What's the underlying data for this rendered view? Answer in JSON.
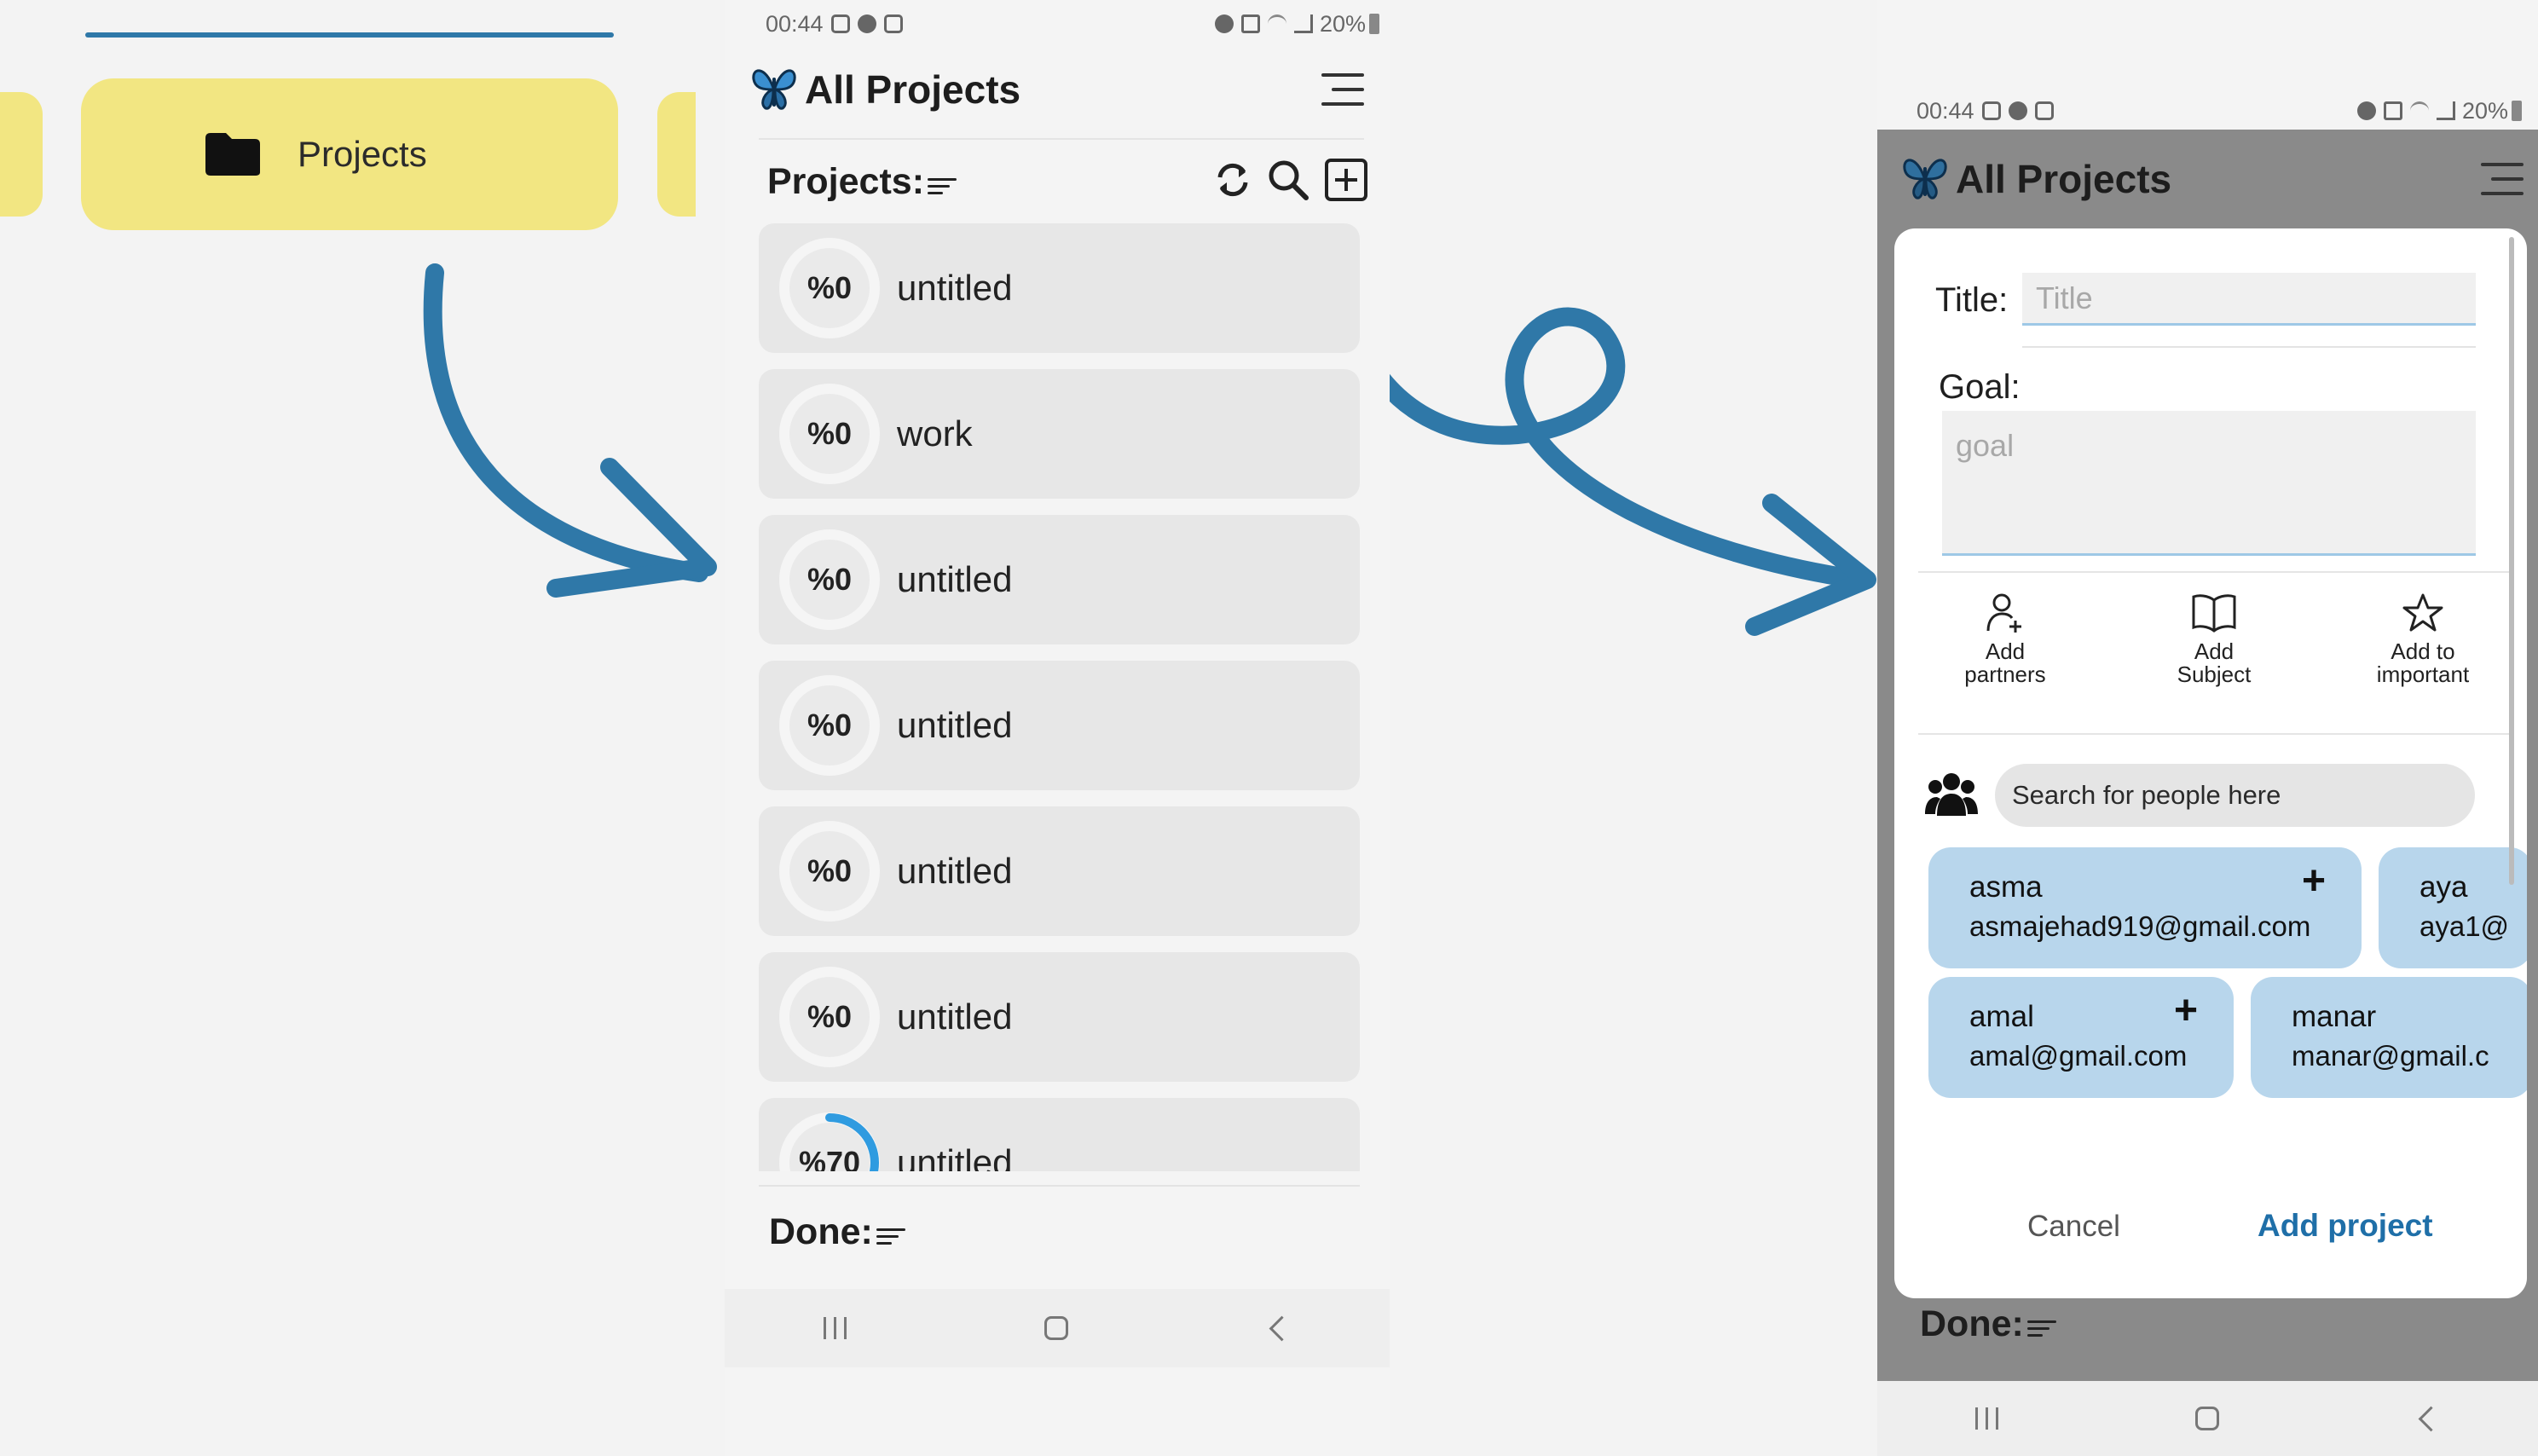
{
  "panel1": {
    "card_label": "Projects"
  },
  "panel2": {
    "status": {
      "time": "00:44",
      "battery": "20%"
    },
    "app_title": "All Projects",
    "section_title": "Projects:",
    "projects": [
      {
        "name": "untitled",
        "progress_label": "%0",
        "progress": 0
      },
      {
        "name": "work",
        "progress_label": "%0",
        "progress": 0
      },
      {
        "name": "untitled",
        "progress_label": "%0",
        "progress": 0
      },
      {
        "name": "untitled",
        "progress_label": "%0",
        "progress": 0
      },
      {
        "name": "untitled",
        "progress_label": "%0",
        "progress": 0
      },
      {
        "name": "untitled",
        "progress_label": "%0",
        "progress": 0
      },
      {
        "name": "untitled",
        "progress_label": "%70",
        "progress": 0.7
      }
    ],
    "done_title": "Done:"
  },
  "panel3": {
    "status": {
      "time": "00:44",
      "battery": "20%"
    },
    "app_title": "All Projects",
    "dialog": {
      "title_label": "Title:",
      "title_placeholder": "Title",
      "goal_label": "Goal:",
      "goal_placeholder": "goal",
      "actions": {
        "partners": "Add\npartners",
        "subject": "Add\nSubject",
        "important": "Add to\nimportant"
      },
      "search_placeholder": "Search for people here",
      "people": [
        {
          "name": "asma",
          "email": "asmajehad919@gmail.com"
        },
        {
          "name": "aya",
          "email": "aya1@"
        },
        {
          "name": "amal",
          "email": "amal@gmail.com"
        },
        {
          "name": "manar",
          "email": "manar@gmail.c"
        }
      ],
      "cancel_label": "Cancel",
      "add_label": "Add project"
    },
    "done_title": "Done:"
  },
  "colors": {
    "accent": "#2f78a8",
    "card_yellow": "#f2e682",
    "chip_blue": "#b8d6ec",
    "progress_blue": "#2f9be0"
  }
}
